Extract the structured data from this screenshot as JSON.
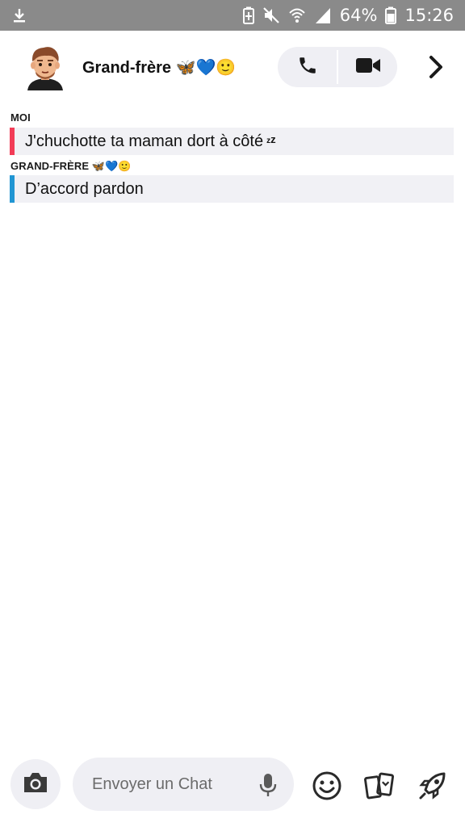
{
  "status_bar": {
    "battery_percent": "64%",
    "time": "15:26"
  },
  "header": {
    "contact_name": "Grand-frère 🦋💙🙂"
  },
  "messages": [
    {
      "sender": "MOI",
      "text": "J'chuchotte ta maman dort à côté",
      "accent_color": "#f23c57"
    },
    {
      "sender": "GRAND-FRÈRE 🦋💙🙂",
      "text": "D’accord pardon",
      "accent_color": "#2196d3"
    }
  ],
  "composer": {
    "placeholder": "Envoyer un Chat"
  },
  "icons": {
    "status": [
      "download-icon",
      "battery-saver-icon",
      "mute-icon",
      "wifi-icon",
      "signal-icon",
      "battery-icon"
    ],
    "header": [
      "avatar",
      "phone-icon",
      "video-camera-icon",
      "chevron-right-icon"
    ],
    "bottom": [
      "camera-icon",
      "microphone-icon",
      "smiley-icon",
      "cards-icon",
      "rocket-icon"
    ]
  }
}
